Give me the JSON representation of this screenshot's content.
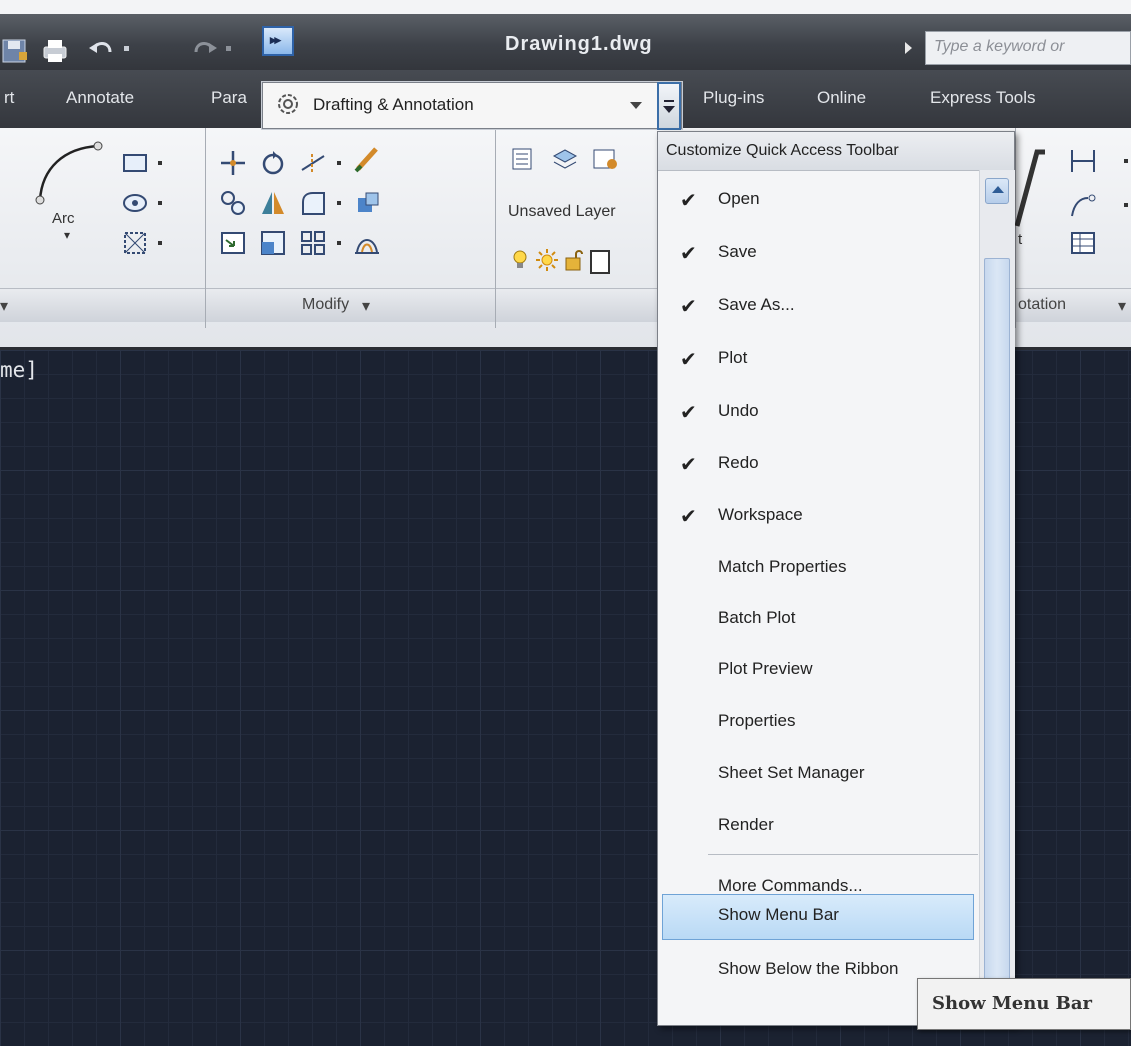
{
  "window": {
    "title": "Drawing1.dwg",
    "search_placeholder": "Type a keyword or"
  },
  "tabs": [
    {
      "label": "rt"
    },
    {
      "label": "Annotate"
    },
    {
      "label": "Para"
    },
    {
      "label": "Plug-ins"
    },
    {
      "label": "Online"
    },
    {
      "label": "Express Tools"
    }
  ],
  "workspace": {
    "current": "Drafting & Annotation"
  },
  "ribbon": {
    "arc_label": "Arc",
    "layer_combo": "Unsaved Layer",
    "panels": [
      {
        "title": "Modify"
      },
      {
        "title": "otation"
      }
    ],
    "text_label": "t"
  },
  "canvas": {
    "viewport_label": "me]"
  },
  "menu": {
    "header": "Customize Quick Access Toolbar",
    "items": [
      {
        "label": "Open",
        "checked": "✔"
      },
      {
        "label": "Save",
        "checked": "✔"
      },
      {
        "label": "Save As...",
        "checked": "✔"
      },
      {
        "label": "Plot",
        "checked": "✔"
      },
      {
        "label": "Undo",
        "checked": "✔"
      },
      {
        "label": "Redo",
        "checked": "✔"
      },
      {
        "label": "Workspace",
        "checked": "✔"
      },
      {
        "label": "Match Properties",
        "checked": ""
      },
      {
        "label": "Batch Plot",
        "checked": ""
      },
      {
        "label": "Plot Preview",
        "checked": ""
      },
      {
        "label": "Properties",
        "checked": ""
      },
      {
        "label": "Sheet Set Manager",
        "checked": ""
      },
      {
        "label": "Render",
        "checked": ""
      }
    ],
    "extra_items": [
      {
        "label": "More Commands..."
      },
      {
        "label": "Show Menu Bar"
      },
      {
        "label": "Show Below the Ribbon"
      }
    ]
  },
  "tooltip": {
    "text": "Show Menu Bar"
  },
  "colors": {
    "accent_blue": "#2e62a8",
    "highlight": "#b9d9f5",
    "canvas_bg": "#1b2231"
  }
}
